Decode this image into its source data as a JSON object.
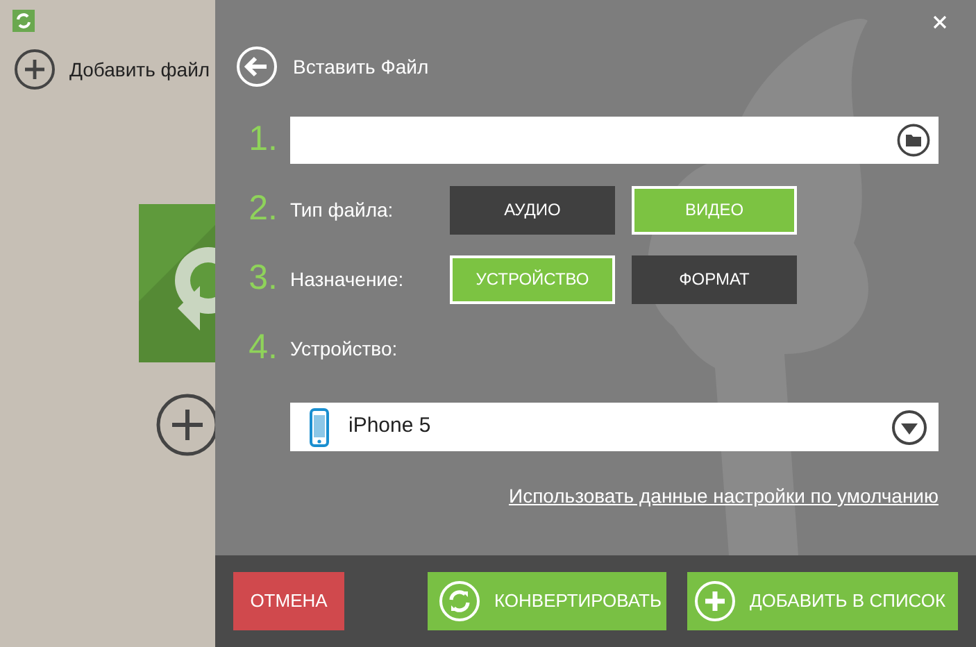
{
  "app": {
    "add_file_label": "Добавить файл"
  },
  "dialog": {
    "title": "Вставить Файл",
    "steps": [
      {
        "number": "1.",
        "kind": "path"
      },
      {
        "number": "2.",
        "kind": "toggle",
        "label": "Тип файла:",
        "options": [
          {
            "label": "АУДИО",
            "selected": false
          },
          {
            "label": "ВИДЕО",
            "selected": true
          }
        ]
      },
      {
        "number": "3.",
        "kind": "toggle",
        "label": "Назначение:",
        "options": [
          {
            "label": "УСТРОЙСТВО",
            "selected": true
          },
          {
            "label": "ФОРМАТ",
            "selected": false
          }
        ]
      },
      {
        "number": "4.",
        "kind": "device",
        "label": "Устройство:"
      }
    ],
    "device_select": {
      "value": "iPhone 5"
    },
    "defaults_link": "Использовать данные настройки по умолчанию",
    "buttons": [
      {
        "label": "ОТМЕНА",
        "kind": "cancel"
      },
      {
        "label": "КОНВЕРТИРОВАТЬ",
        "kind": "convert"
      },
      {
        "label": "ДОБАВИТЬ В СПИСОК",
        "kind": "add"
      }
    ]
  }
}
